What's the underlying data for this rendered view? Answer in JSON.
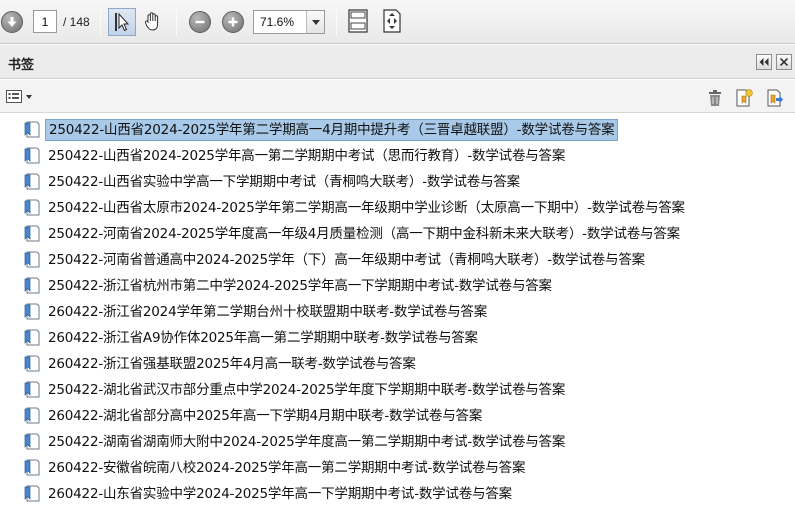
{
  "toolbar": {
    "current_page": "1",
    "total_pages": "/ 148",
    "zoom": "71.6%"
  },
  "panel": {
    "title": "书签"
  },
  "bookmarks": [
    {
      "label": "250422-山西省2024-2025学年第二学期高一4月期中提升考（三晋卓越联盟）-数学试卷与答案",
      "selected": true
    },
    {
      "label": "250422-山西省2024-2025学年高一第二学期期中考试（思而行教育）-数学试卷与答案"
    },
    {
      "label": "250422-山西省实验中学高一下学期期中考试（青桐鸣大联考）-数学试卷与答案"
    },
    {
      "label": "250422-山西省太原市2024-2025学年第二学期高一年级期中学业诊断（太原高一下期中）-数学试卷与答案"
    },
    {
      "label": "250422-河南省2024-2025学年度高一年级4月质量检测（高一下期中金科新未来大联考）-数学试卷与答案"
    },
    {
      "label": "250422-河南省普通高中2024-2025学年（下）高一年级期中考试（青桐鸣大联考）-数学试卷与答案"
    },
    {
      "label": "250422-浙江省杭州市第二中学2024-2025学年高一下学期期中考试-数学试卷与答案"
    },
    {
      "label": "260422-浙江省2024学年第二学期台州十校联盟期中联考-数学试卷与答案"
    },
    {
      "label": "260422-浙江省A9协作体2025年高一第二学期期中联考-数学试卷与答案"
    },
    {
      "label": "260422-浙江省强基联盟2025年4月高一联考-数学试卷与答案"
    },
    {
      "label": "250422-湖北省武汉市部分重点中学2024-2025学年度下学期期中联考-数学试卷与答案"
    },
    {
      "label": "260422-湖北省部分高中2025年高一下学期4月期中联考-数学试卷与答案"
    },
    {
      "label": "250422-湖南省湖南师大附中2024-2025学年度高一第二学期期中考试-数学试卷与答案"
    },
    {
      "label": "260422-安徽省皖南八校2024-2025学年高一第二学期期中考试-数学试卷与答案"
    },
    {
      "label": "260422-山东省实验中学2024-2025学年高一下学期期中考试-数学试卷与答案"
    }
  ]
}
